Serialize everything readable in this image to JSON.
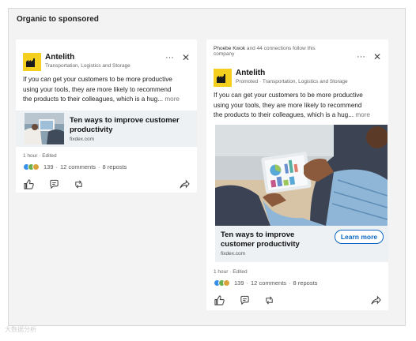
{
  "page": {
    "section_title": "Organic to sponsored",
    "watermark": "大数据分析"
  },
  "organic_post": {
    "company": "Antelith",
    "subtitle": "Transportation, Logistics and Storage",
    "body_line1": "If you can get your customers to be more productive",
    "body_line2": "using your tools, they are more likely to recommend",
    "body_line3": "the products to their colleagues, which is a hug...",
    "more_label": "more",
    "link_title": "Ten ways to improve customer productivity",
    "link_domain": "fixdex.com",
    "time": "1 hour",
    "edited": "Edited",
    "reaction_count": "139",
    "comments": "12 comments",
    "reposts": "8 reposts"
  },
  "sponsored_post": {
    "social_context_name": "Phoebe Kwok",
    "social_context_rest": " and 44 connections follow this",
    "social_context_line2": "company",
    "company": "Antelith",
    "subtitle": "Promoted · Transportation, Logistics and Storage",
    "body_line1": "If you can get your customers to be more productive",
    "body_line2": "using your tools, they are more likely to recommend",
    "body_line3": "the products to their colleagues, which is a hug...",
    "more_label": "more",
    "ad_title": "Ten ways to improve customer productivity",
    "ad_domain": "fixdex.com",
    "cta_label": "Learn more",
    "time": "1 hour",
    "edited": "Edited",
    "reaction_count": "139",
    "comments": "12 comments",
    "reposts": "8 reposts"
  },
  "icons": {
    "menu": "more-dots-icon",
    "close": "close-icon",
    "like": "like-icon",
    "comment": "comment-icon",
    "repost": "repost-icon",
    "send": "send-icon"
  },
  "colors": {
    "brand_yellow": "#f5cf1d",
    "cta_blue": "#0a66c2",
    "preview_bg": "#edf1f4"
  }
}
